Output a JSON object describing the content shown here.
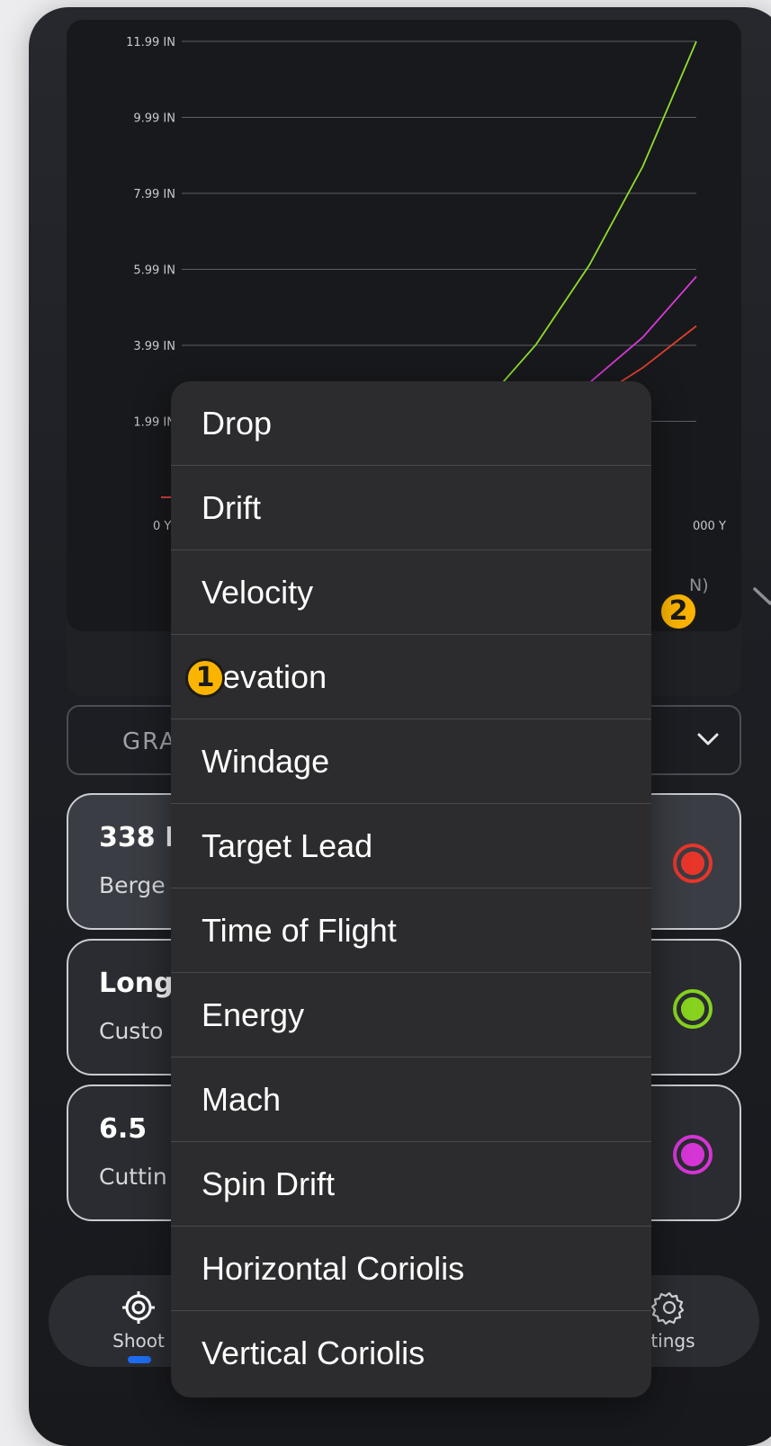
{
  "chart_data": {
    "type": "line",
    "y_ticks": [
      "11.99 IN",
      "9.99 IN",
      "7.99 IN",
      "5.99 IN",
      "3.99 IN",
      "1.99 IN"
    ],
    "x_tick_start": "0 Y",
    "x_tick_end_visible": "000 Y",
    "series": [
      {
        "color": "#8fdc2e",
        "points": [
          [
            0.0,
            -0.01
          ],
          [
            0.1,
            -0.01
          ],
          [
            0.2,
            0.0
          ],
          [
            0.3,
            0.2
          ],
          [
            0.4,
            0.6
          ],
          [
            0.5,
            1.3
          ],
          [
            0.6,
            2.4
          ],
          [
            0.7,
            4.0
          ],
          [
            0.8,
            6.1
          ],
          [
            0.9,
            8.7
          ],
          [
            1.0,
            11.99
          ]
        ]
      },
      {
        "color": "#d63ad6",
        "points": [
          [
            0.0,
            -0.01
          ],
          [
            0.1,
            -0.01
          ],
          [
            0.2,
            0.0
          ],
          [
            0.3,
            0.1
          ],
          [
            0.4,
            0.3
          ],
          [
            0.5,
            0.7
          ],
          [
            0.6,
            1.2
          ],
          [
            0.7,
            2.0
          ],
          [
            0.8,
            3.0
          ],
          [
            0.9,
            4.2
          ],
          [
            1.0,
            5.8
          ]
        ]
      },
      {
        "color": "#e0402c",
        "points": [
          [
            0.0,
            -0.01
          ],
          [
            0.1,
            -0.01
          ],
          [
            0.2,
            0.0
          ],
          [
            0.3,
            0.1
          ],
          [
            0.4,
            0.3
          ],
          [
            0.5,
            0.6
          ],
          [
            0.6,
            1.0
          ],
          [
            0.7,
            1.7
          ],
          [
            0.8,
            2.5
          ],
          [
            0.9,
            3.4
          ],
          [
            1.0,
            4.5
          ]
        ]
      }
    ],
    "ylim": [
      -1.99,
      11.99
    ]
  },
  "series_selector": {
    "visible_text": "N)"
  },
  "badges": {
    "one": "1",
    "two": "2"
  },
  "grade": {
    "label": "GRA"
  },
  "loads": [
    {
      "name": "338 E",
      "sub": "Berge",
      "color": "#e8352a",
      "active": true
    },
    {
      "name": "Long",
      "sub": "Custo",
      "color": "#86d21f",
      "active": false
    },
    {
      "name": "6.5",
      "sub": "Cuttin",
      "color": "#d535d5",
      "active": false
    }
  ],
  "tabbar": {
    "shoot_label": "Shoot",
    "settings_label": "ttings"
  },
  "dropdown": {
    "items": [
      "Drop",
      "Drift",
      "Velocity",
      "evation",
      "Windage",
      "Target Lead",
      "Time of Flight",
      "Energy",
      "Mach",
      "Spin Drift",
      "Horizontal Coriolis",
      "Vertical Coriolis"
    ]
  }
}
